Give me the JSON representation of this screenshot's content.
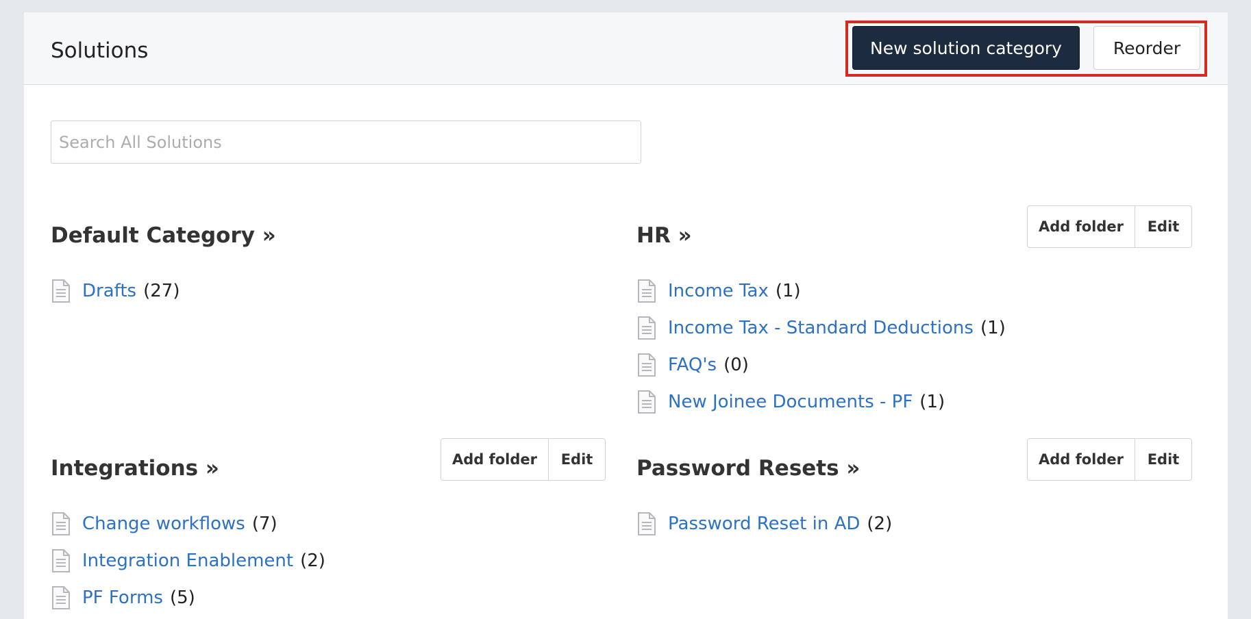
{
  "header": {
    "title": "Solutions",
    "new_category_label": "New solution category",
    "reorder_label": "Reorder"
  },
  "search": {
    "placeholder": "Search All Solutions",
    "value": ""
  },
  "colors": {
    "primary_button": "#1c2b3d",
    "link": "#2a71c7",
    "highlight": "#d42b1e"
  },
  "categories": [
    {
      "title": "Default Category »",
      "add_folder_label": "",
      "edit_label": "",
      "folders": [
        {
          "name": "Drafts",
          "count": "(27)"
        }
      ]
    },
    {
      "title": "HR »",
      "add_folder_label": "Add folder",
      "edit_label": "Edit",
      "folders": [
        {
          "name": "Income Tax",
          "count": "(1)"
        },
        {
          "name": "Income Tax - Standard Deductions",
          "count": "(1)"
        },
        {
          "name": "FAQ's",
          "count": "(0)"
        },
        {
          "name": "New Joinee Documents - PF",
          "count": "(1)"
        }
      ]
    },
    {
      "title": "Integrations »",
      "add_folder_label": "Add folder",
      "edit_label": "Edit",
      "folders": [
        {
          "name": "Change workflows",
          "count": "(7)"
        },
        {
          "name": "Integration Enablement",
          "count": "(2)"
        },
        {
          "name": "PF Forms",
          "count": "(5)"
        }
      ]
    },
    {
      "title": "Password Resets »",
      "add_folder_label": "Add folder",
      "edit_label": "Edit",
      "folders": [
        {
          "name": "Password Reset in AD",
          "count": "(2)"
        }
      ]
    }
  ],
  "icons": {
    "folder_item": "document-icon"
  }
}
